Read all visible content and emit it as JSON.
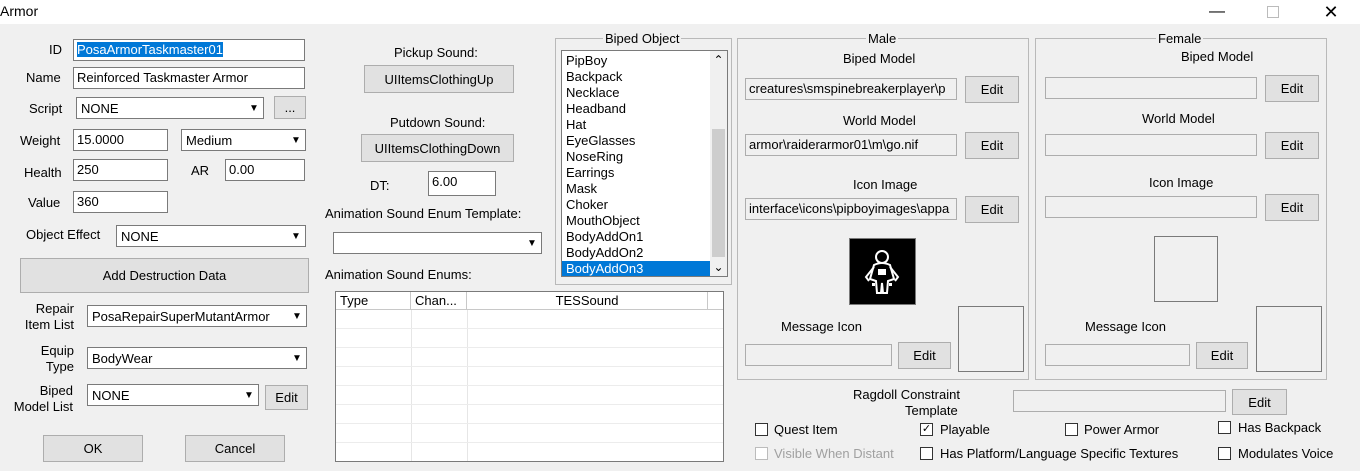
{
  "window": {
    "title": "Armor"
  },
  "general": {
    "id_label": "ID",
    "id_value": "PosaArmorTaskmaster01",
    "name_label": "Name",
    "name_value": "Reinforced Taskmaster Armor",
    "script_label": "Script",
    "script_value": "NONE",
    "script_browse": "...",
    "weight_label": "Weight",
    "weight_value": "15.0000",
    "weight_class": "Medium",
    "health_label": "Health",
    "health_value": "250",
    "ar_label": "AR",
    "ar_value": "0.00",
    "value_label": "Value",
    "value_value": "360",
    "object_effect_label": "Object Effect",
    "object_effect_value": "NONE",
    "add_destruction_label": "Add Destruction Data",
    "repair_list_label_1": "Repair",
    "repair_list_label_2": "Item List",
    "repair_list_value": "PosaRepairSuperMutantArmor",
    "equip_type_label_1": "Equip",
    "equip_type_label_2": "Type",
    "equip_type_value": "BodyWear",
    "biped_model_list_label_1": "Biped",
    "biped_model_list_label_2": "Model List",
    "biped_model_list_value": "NONE",
    "biped_model_list_edit": "Edit",
    "ok_label": "OK",
    "cancel_label": "Cancel"
  },
  "sounds": {
    "pickup_label": "Pickup Sound:",
    "pickup_value": "UIItemsClothingUp",
    "putdown_label": "Putdown Sound:",
    "putdown_value": "UIItemsClothingDown",
    "dt_label": "DT:",
    "dt_value": "6.00",
    "anim_template_label": "Animation Sound Enum Template:",
    "anim_template_value": "",
    "anim_enums_label": "Animation Sound Enums:",
    "enum_columns": [
      "Type",
      "Chan...",
      "TESSound"
    ]
  },
  "biped_object": {
    "legend": "Biped Object",
    "items": [
      "PipBoy",
      "Backpack",
      "Necklace",
      "Headband",
      "Hat",
      "EyeGlasses",
      "NoseRing",
      "Earrings",
      "Mask",
      "Choker",
      "MouthObject",
      "BodyAddOn1",
      "BodyAddOn2",
      "BodyAddOn3"
    ],
    "selected": "BodyAddOn3"
  },
  "male": {
    "legend": "Male",
    "biped_model_label": "Biped Model",
    "biped_model_path": "creatures\\smspinebreakerplayer\\p",
    "world_model_label": "World Model",
    "world_model_path": "armor\\raiderarmor01\\m\\go.nif",
    "icon_image_label": "Icon Image",
    "icon_image_path": "interface\\icons\\pipboyimages\\appa",
    "message_icon_label": "Message Icon",
    "message_icon_path": "",
    "edit_label": "Edit"
  },
  "female": {
    "legend": "Female",
    "biped_model_label": "Biped Model",
    "biped_model_path": "",
    "world_model_label": "World Model",
    "world_model_path": "",
    "icon_image_label": "Icon Image",
    "icon_image_path": "",
    "message_icon_label": "Message Icon",
    "message_icon_path": "",
    "edit_label": "Edit"
  },
  "ragdoll": {
    "label_1": "Ragdoll Constraint",
    "label_2": "Template",
    "value": "",
    "edit_label": "Edit"
  },
  "flags": {
    "quest_item": {
      "label": "Quest Item",
      "checked": false,
      "enabled": true
    },
    "playable": {
      "label": "Playable",
      "checked": true,
      "enabled": true
    },
    "power_armor": {
      "label": "Power Armor",
      "checked": false,
      "enabled": true
    },
    "has_backpack": {
      "label": "Has Backpack",
      "checked": false,
      "enabled": true
    },
    "visible_when_distant": {
      "label": "Visible When Distant",
      "checked": false,
      "enabled": false
    },
    "has_platform_textures": {
      "label": "Has Platform/Language Specific Textures",
      "checked": false,
      "enabled": true
    },
    "modulates_voice": {
      "label": "Modulates Voice",
      "checked": false,
      "enabled": true
    }
  },
  "colors": {
    "selection": "#0078d7",
    "window_bg": "#f0f0f0"
  }
}
